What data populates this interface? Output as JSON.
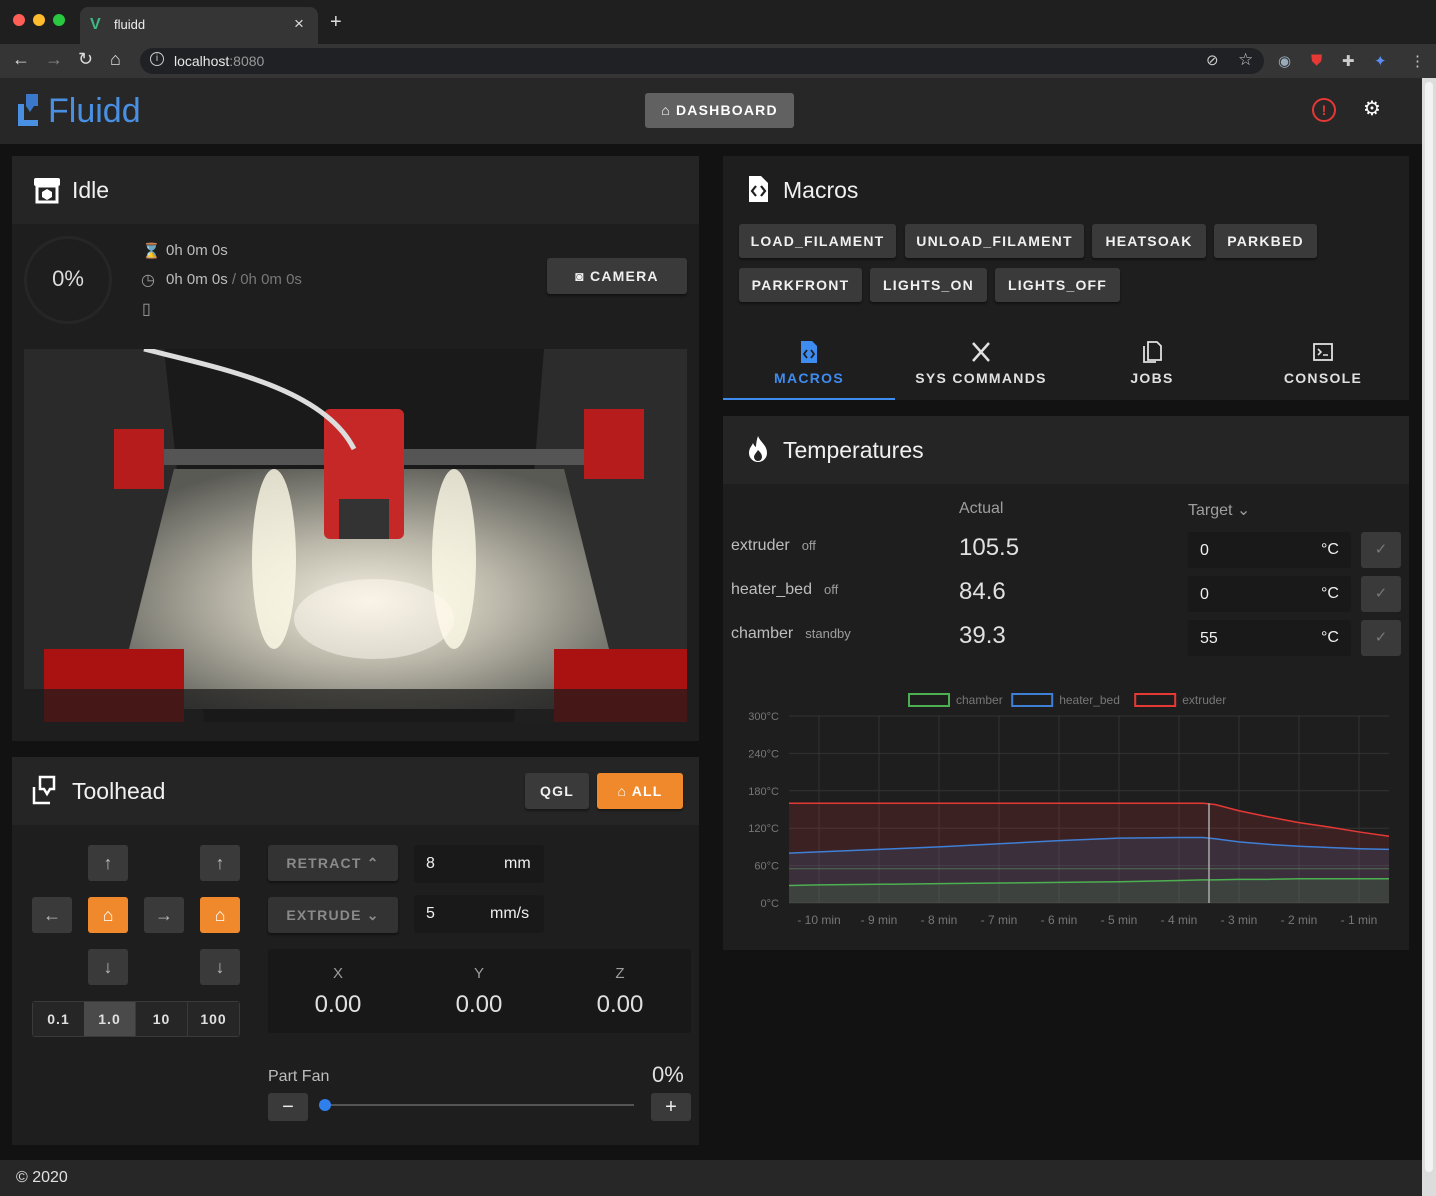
{
  "browser": {
    "tab_title": "fluidd",
    "url_host": "localhost",
    "url_port": ":8080"
  },
  "appbar": {
    "logo": "Fluidd",
    "dashboard_label": "DASHBOARD"
  },
  "status": {
    "title": "Idle",
    "progress": "0%",
    "elapsed": "0h 0m 0s",
    "time_left": "0h 0m 0s",
    "time_sep": " / ",
    "time_total": "0h 0m 0s",
    "camera_label": "CAMERA"
  },
  "toolhead": {
    "title": "Toolhead",
    "qgl_label": "QGL",
    "home_all_label": "ALL",
    "retract_label": "RETRACT",
    "extrude_label": "EXTRUDE",
    "length_value": "8",
    "length_unit": "mm",
    "speed_value": "5",
    "speed_unit": "mm/s",
    "steps": [
      "0.1",
      "1.0",
      "10",
      "100"
    ],
    "selected_step": "1.0",
    "axes": [
      {
        "label": "X",
        "value": "0.00"
      },
      {
        "label": "Y",
        "value": "0.00"
      },
      {
        "label": "Z",
        "value": "0.00"
      }
    ],
    "part_fan_label": "Part Fan",
    "part_fan_value": "0%"
  },
  "macros": {
    "title": "Macros",
    "buttons": [
      "LOAD_FILAMENT",
      "UNLOAD_FILAMENT",
      "HEATSOAK",
      "PARKBED",
      "PARKFRONT",
      "LIGHTS_ON",
      "LIGHTS_OFF"
    ],
    "tabs": [
      {
        "label": "MACROS",
        "active": true
      },
      {
        "label": "SYS COMMANDS",
        "active": false
      },
      {
        "label": "JOBS",
        "active": false
      },
      {
        "label": "CONSOLE",
        "active": false
      }
    ]
  },
  "temperatures": {
    "title": "Temperatures",
    "col_actual": "Actual",
    "col_target": "Target",
    "unit": "°C",
    "rows": [
      {
        "name": "extruder",
        "state": "off",
        "actual": "105.5",
        "target": "0"
      },
      {
        "name": "heater_bed",
        "state": "off",
        "actual": "84.6",
        "target": "0"
      },
      {
        "name": "chamber",
        "state": "standby",
        "actual": "39.3",
        "target": "55"
      }
    ]
  },
  "chart_data": {
    "type": "line",
    "x": [
      -10.5,
      -10,
      -9,
      -8,
      -7,
      -6,
      -5,
      -4,
      -3.6,
      -3.4,
      -3,
      -2.5,
      -2,
      -1.5,
      -1,
      -0.5
    ],
    "x_tick_labels": [
      "- 10 min",
      "- 9 min",
      "- 8 min",
      "- 7 min",
      "- 6 min",
      "- 5 min",
      "- 4 min",
      "- 3 min",
      "- 2 min",
      "- 1 min"
    ],
    "y_tick_labels": [
      "300°C",
      "240°C",
      "180°C",
      "120°C",
      "60°C",
      "0°C"
    ],
    "ylim": [
      0,
      300
    ],
    "grid": true,
    "legend_position": "top",
    "series": [
      {
        "name": "chamber",
        "color": "#4caf50",
        "values": [
          28,
          29,
          30,
          31,
          32,
          33,
          34,
          36,
          37,
          37,
          38,
          38,
          39,
          39,
          39,
          39
        ]
      },
      {
        "name": "heater_bed",
        "color": "#3f7fd6",
        "values": [
          80,
          82,
          86,
          90,
          95,
          100,
          104,
          105,
          105,
          103,
          98,
          94,
          91,
          89,
          87,
          86
        ]
      },
      {
        "name": "extruder",
        "color": "#e53935",
        "values": [
          160,
          160,
          160,
          160,
          160,
          160,
          160,
          160,
          160,
          158,
          148,
          138,
          129,
          122,
          114,
          107
        ]
      }
    ],
    "target_series": [
      {
        "name": "chamber",
        "values": [
          55,
          55,
          55,
          55,
          55,
          55,
          55,
          55,
          55,
          55,
          55,
          55,
          55,
          55,
          55,
          55
        ]
      }
    ]
  },
  "footer": {
    "copyright": "© 2020"
  }
}
